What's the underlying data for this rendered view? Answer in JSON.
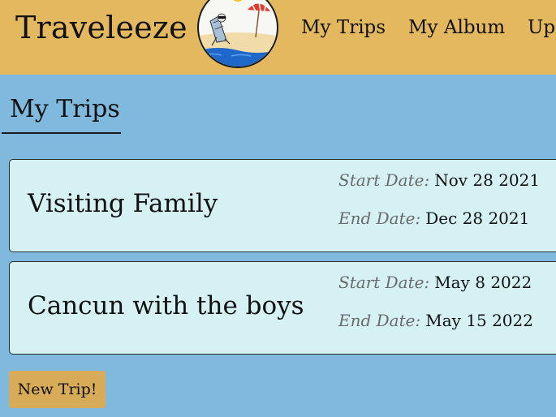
{
  "header": {
    "brand": "Traveleeze",
    "logo_icon": "beach-chair-umbrella-logo-icon",
    "nav": [
      {
        "label": "My Trips"
      },
      {
        "label": "My Album"
      },
      {
        "label": "Upl"
      }
    ]
  },
  "main": {
    "title": "My Trips",
    "trips": [
      {
        "name": "Visiting Family",
        "start_label": "Start Date:",
        "start_date": "Nov 28 2021",
        "end_label": "End Date:",
        "end_date": "Dec 28 2021"
      },
      {
        "name": "Cancun with the boys",
        "start_label": "Start Date:",
        "start_date": "May 8 2022",
        "end_label": "End Date:",
        "end_date": "May 15 2022"
      }
    ],
    "new_trip_label": "New Trip!"
  },
  "colors": {
    "header_bg": "#e3b85f",
    "page_bg": "#7fb9de",
    "card_bg": "#d5f1f4",
    "button_bg": "#d7ab58"
  }
}
